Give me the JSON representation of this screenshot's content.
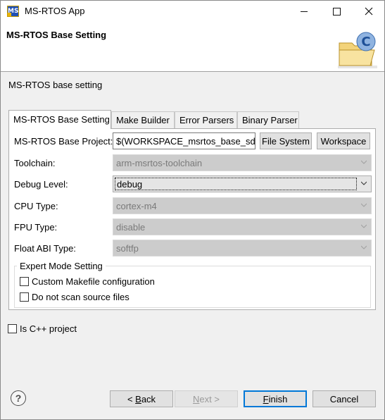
{
  "window": {
    "title": "MS-RTOS App",
    "icon_text": "MS",
    "controls": {
      "minimize": "minimize-icon",
      "maximize": "maximize-icon",
      "close": "close-icon"
    }
  },
  "header": {
    "title": "MS-RTOS Base Setting",
    "banner_icon": "folder-c-icon"
  },
  "page": {
    "description": "MS-RTOS base setting"
  },
  "tabs": [
    {
      "label": "MS-RTOS Base Setting",
      "active": true
    },
    {
      "label": "Make Builder",
      "active": false
    },
    {
      "label": "Error Parsers",
      "active": false
    },
    {
      "label": "Binary Parser",
      "active": false
    }
  ],
  "form": {
    "base_project": {
      "label": "MS-RTOS Base Project:",
      "value": "$(WORKSPACE_msrtos_base_sdk)"
    },
    "file_system_button": "File System",
    "workspace_button": "Workspace",
    "toolchain": {
      "label": "Toolchain:",
      "value": "arm-msrtos-toolchain",
      "enabled": false
    },
    "debug_level": {
      "label": "Debug Level:",
      "value": "debug",
      "enabled": true
    },
    "cpu_type": {
      "label": "CPU Type:",
      "value": "cortex-m4",
      "enabled": false
    },
    "fpu_type": {
      "label": "FPU Type:",
      "value": "disable",
      "enabled": false
    },
    "float_abi": {
      "label": "Float ABI Type:",
      "value": "softfp",
      "enabled": false
    }
  },
  "expert": {
    "title": "Expert Mode Setting",
    "custom_makefile": {
      "label": "Custom Makefile configuration",
      "checked": false
    },
    "no_scan": {
      "label": "Do not scan source files",
      "checked": false
    }
  },
  "cpp_project": {
    "label": "Is C++ project",
    "checked": false
  },
  "footer": {
    "help_icon": "help-icon",
    "back_prefix": "< ",
    "back_mnemonic": "B",
    "back_rest": "ack",
    "next_mnemonic": "N",
    "next_rest": "ext >",
    "finish_mnemonic": "F",
    "finish_rest": "inish",
    "cancel": "Cancel"
  }
}
